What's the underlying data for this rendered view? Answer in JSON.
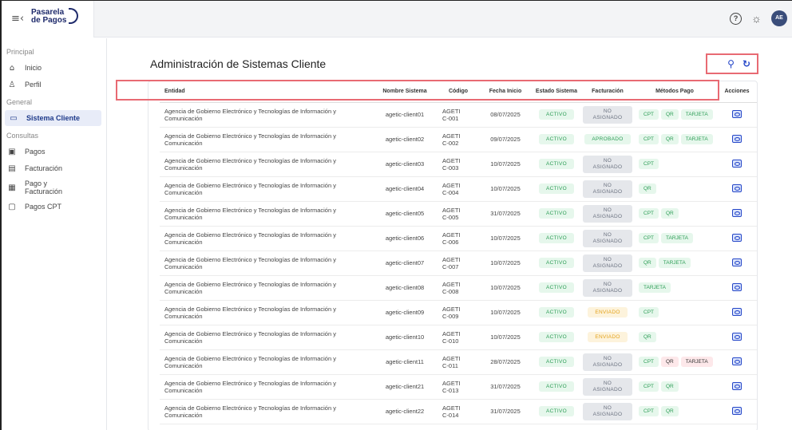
{
  "header": {
    "brand_line1": "Pasarela",
    "brand_line2": "de Pagos",
    "menu_icon": "menu-collapse-icon",
    "help_icon": "help-icon",
    "theme_icon": "sun-icon",
    "avatar_initials": "AE"
  },
  "sidebar": {
    "sections": [
      {
        "title": "Principal",
        "items": [
          {
            "label": "Inicio",
            "icon": "home-icon"
          },
          {
            "label": "Perfil",
            "icon": "user-icon"
          }
        ]
      },
      {
        "title": "General",
        "items": [
          {
            "label": "Sistema Cliente",
            "icon": "laptop-icon",
            "active": true
          }
        ]
      },
      {
        "title": "Consultas",
        "items": [
          {
            "label": "Pagos",
            "icon": "cash-icon"
          },
          {
            "label": "Facturación",
            "icon": "invoice-icon"
          },
          {
            "label": "Pago y Facturación",
            "icon": "payment-invoice-icon"
          },
          {
            "label": "Pagos CPT",
            "icon": "cpt-icon"
          }
        ]
      }
    ]
  },
  "main": {
    "title": "Administración de Sistemas Cliente",
    "actions": {
      "search_icon": "search-icon",
      "refresh_icon": "refresh-icon"
    },
    "columns": [
      "Entidad",
      "Nombre Sistema",
      "Código",
      "Fecha Inicio",
      "Estado Sistema",
      "Facturación",
      "Métodos Pago",
      "Acciones"
    ],
    "rows": [
      {
        "entity": "Agencia de Gobierno Electrónico y Tecnologías de Información y Comunicación",
        "system": "agetic-client01",
        "code": "AGETIC-001",
        "date": "08/07/2025",
        "status": "ACTIVO",
        "billing": "NO ASIGNADO",
        "methods": [
          "CPT",
          "QR",
          "TARJETA"
        ]
      },
      {
        "entity": "Agencia de Gobierno Electrónico y Tecnologías de Información y Comunicación",
        "system": "agetic-client02",
        "code": "AGETIC-002",
        "date": "09/07/2025",
        "status": "ACTIVO",
        "billing": "APROBADO",
        "methods": [
          "CPT",
          "QR",
          "TARJETA"
        ]
      },
      {
        "entity": "Agencia de Gobierno Electrónico y Tecnologías de Información y Comunicación",
        "system": "agetic-client03",
        "code": "AGETIC-003",
        "date": "10/07/2025",
        "status": "ACTIVO",
        "billing": "NO ASIGNADO",
        "methods": [
          "CPT"
        ]
      },
      {
        "entity": "Agencia de Gobierno Electrónico y Tecnologías de Información y Comunicación",
        "system": "agetic-client04",
        "code": "AGETIC-004",
        "date": "10/07/2025",
        "status": "ACTIVO",
        "billing": "NO ASIGNADO",
        "methods": [
          "QR"
        ]
      },
      {
        "entity": "Agencia de Gobierno Electrónico y Tecnologías de Información y Comunicación",
        "system": "agetic-client05",
        "code": "AGETIC-005",
        "date": "31/07/2025",
        "status": "ACTIVO",
        "billing": "NO ASIGNADO",
        "methods": [
          "CPT",
          "QR"
        ]
      },
      {
        "entity": "Agencia de Gobierno Electrónico y Tecnologías de Información y Comunicación",
        "system": "agetic-client06",
        "code": "AGETIC-006",
        "date": "10/07/2025",
        "status": "ACTIVO",
        "billing": "NO ASIGNADO",
        "methods": [
          "CPT",
          "TARJETA"
        ]
      },
      {
        "entity": "Agencia de Gobierno Electrónico y Tecnologías de Información y Comunicación",
        "system": "agetic-client07",
        "code": "AGETIC-007",
        "date": "10/07/2025",
        "status": "ACTIVO",
        "billing": "NO ASIGNADO",
        "methods": [
          "QR",
          "TARJETA"
        ]
      },
      {
        "entity": "Agencia de Gobierno Electrónico y Tecnologías de Información y Comunicación",
        "system": "agetic-client08",
        "code": "AGETIC-008",
        "date": "10/07/2025",
        "status": "ACTIVO",
        "billing": "NO ASIGNADO",
        "methods": [
          "TARJETA"
        ]
      },
      {
        "entity": "Agencia de Gobierno Electrónico y Tecnologías de Información y Comunicación",
        "system": "agetic-client09",
        "code": "AGETIC-009",
        "date": "10/07/2025",
        "status": "ACTIVO",
        "billing": "ENVIADO",
        "methods": [
          "CPT"
        ]
      },
      {
        "entity": "Agencia de Gobierno Electrónico y Tecnologías de Información y Comunicación",
        "system": "agetic-client10",
        "code": "AGETIC-010",
        "date": "10/07/2025",
        "status": "ACTIVO",
        "billing": "ENVIADO",
        "methods": [
          "QR"
        ]
      },
      {
        "entity": "Agencia de Gobierno Electrónico y Tecnologías de Información y Comunicación",
        "system": "agetic-client11",
        "code": "AGETIC-011",
        "date": "28/07/2025",
        "status": "ACTIVO",
        "billing": "NO ASIGNADO",
        "methods": [
          "CPT",
          "QR",
          "TARJETA"
        ]
      },
      {
        "entity": "Agencia de Gobierno Electrónico y Tecnologías de Información y Comunicación",
        "system": "agetic-client21",
        "code": "AGETIC-013",
        "date": "31/07/2025",
        "status": "ACTIVO",
        "billing": "NO ASIGNADO",
        "methods": [
          "CPT",
          "QR"
        ]
      },
      {
        "entity": "Agencia de Gobierno Electrónico y Tecnologías de Información y Comunicación",
        "system": "agetic-client22",
        "code": "AGETIC-014",
        "date": "31/07/2025",
        "status": "ACTIVO",
        "billing": "NO ASIGNADO",
        "methods": [
          "CPT",
          "QR"
        ]
      }
    ],
    "colors": {
      "accent": "#2446c8",
      "highlight_border": "#e86a73",
      "active_green": "#2e9e57",
      "pending_amber": "#e3a21a"
    }
  }
}
